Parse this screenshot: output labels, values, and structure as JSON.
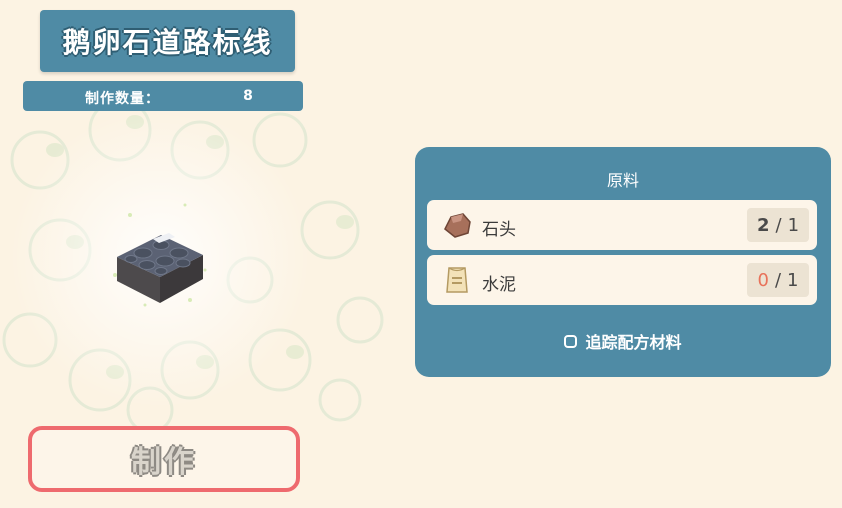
{
  "item": {
    "title": "鹅卵石道路标线",
    "quantity_label": "制作数量：",
    "quantity_value": "8"
  },
  "craft_button": {
    "label": "制作"
  },
  "recipe": {
    "title": "原料",
    "ingredients": [
      {
        "name": "石头",
        "icon": "stone-icon",
        "have": "2",
        "separator": "/",
        "need": "1",
        "have_color": "#4a4a4a"
      },
      {
        "name": "水泥",
        "icon": "cement-bag-icon",
        "have": "0",
        "separator": "/",
        "need": "1",
        "have_color": "#e8725a"
      }
    ],
    "track_label": "追踪配方材料"
  },
  "colors": {
    "panel": "#4f8ba5",
    "background": "#fcf3e3",
    "craft_border": "#ee6a6e",
    "shortage": "#e8725a"
  }
}
